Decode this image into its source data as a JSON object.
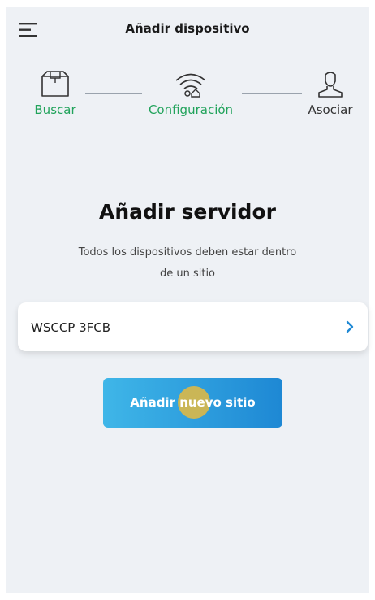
{
  "header": {
    "title": "Añadir dispositivo",
    "menu_icon": "menu-icon"
  },
  "steps": [
    {
      "label": "Buscar",
      "icon": "box-icon",
      "state": "done"
    },
    {
      "label": "Configuración",
      "icon": "wifi-home-icon",
      "state": "done"
    },
    {
      "label": "Asociar",
      "icon": "user-icon",
      "state": "todo"
    }
  ],
  "main": {
    "heading": "Añadir servidor",
    "description_line1": "Todos los dispositivos deben estar dentro",
    "description_line2": "de un sitio"
  },
  "sites": [
    {
      "name": "WSCCP 3FCB"
    }
  ],
  "actions": {
    "add_site_label": "Añadir nuevo sitio"
  },
  "colors": {
    "accent_green": "#21a35b",
    "button_gradient_start": "#3fb6e8",
    "button_gradient_end": "#1e88d4",
    "chevron_blue": "#1e88d4",
    "background": "#eef1f5"
  }
}
